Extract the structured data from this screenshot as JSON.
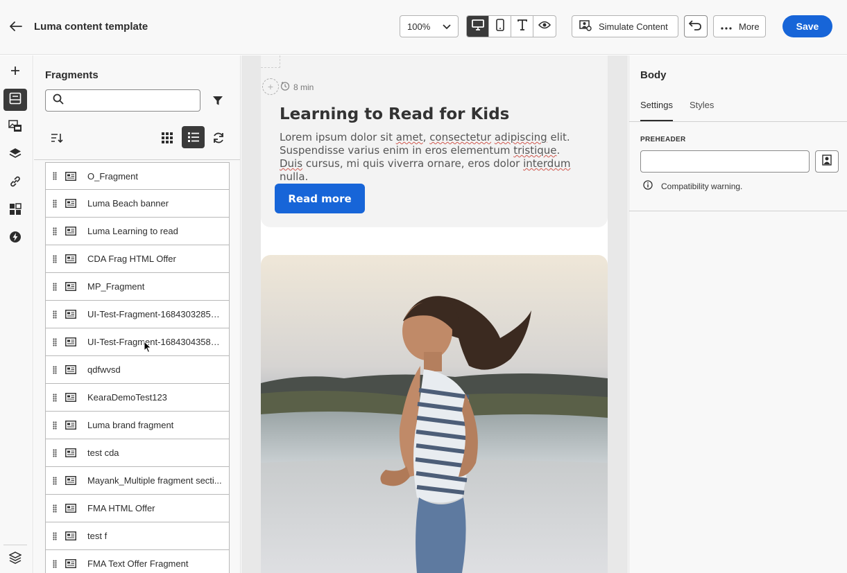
{
  "header": {
    "title": "Luma content template",
    "zoom": "100%",
    "simulate_label": "Simulate Content",
    "more_label": "More",
    "save_label": "Save"
  },
  "fragments_panel": {
    "title": "Fragments",
    "search_value": "",
    "items": [
      {
        "name": "O_Fragment"
      },
      {
        "name": "Luma Beach banner"
      },
      {
        "name": "Luma Learning to read"
      },
      {
        "name": "CDA Frag HTML Offer"
      },
      {
        "name": "MP_Fragment"
      },
      {
        "name": "UI-Test-Fragment-168430328546..."
      },
      {
        "name": "UI-Test-Fragment-168430435899..."
      },
      {
        "name": "qdfwvsd"
      },
      {
        "name": "KearaDemoTest123"
      },
      {
        "name": "Luma brand fragment"
      },
      {
        "name": "test cda"
      },
      {
        "name": "Mayank_Multiple fragment secti..."
      },
      {
        "name": "FMA HTML Offer"
      },
      {
        "name": "test f"
      },
      {
        "name": "FMA Text Offer Fragment"
      }
    ]
  },
  "canvas": {
    "read_time": "8 min",
    "card_title": "Learning to Read for Kids",
    "body_parts": [
      {
        "t": "Lorem ipsum dolor sit ",
        "s": false
      },
      {
        "t": "amet",
        "s": true
      },
      {
        "t": ", ",
        "s": false
      },
      {
        "t": "consectetur",
        "s": true
      },
      {
        "t": " ",
        "s": false
      },
      {
        "t": "adipiscing",
        "s": true
      },
      {
        "t": " elit. Suspendisse varius enim in eros elementum ",
        "s": false
      },
      {
        "t": "tristique",
        "s": true
      },
      {
        "t": ". ",
        "s": false
      },
      {
        "t": "Duis",
        "s": true
      },
      {
        "t": " cursus, mi quis viverra ornare, eros dolor ",
        "s": false
      },
      {
        "t": "interdum",
        "s": true
      },
      {
        "t": " nulla.",
        "s": false
      }
    ],
    "button_label": "Read more"
  },
  "right_panel": {
    "title": "Body",
    "tabs": [
      "Settings",
      "Styles"
    ],
    "active_tab": "Settings",
    "preheader_label": "PREHEADER",
    "preheader_value": "",
    "warning": "Compatibility warning."
  },
  "colors": {
    "accent": "#1765d8",
    "selected": "#3a3a3a"
  }
}
